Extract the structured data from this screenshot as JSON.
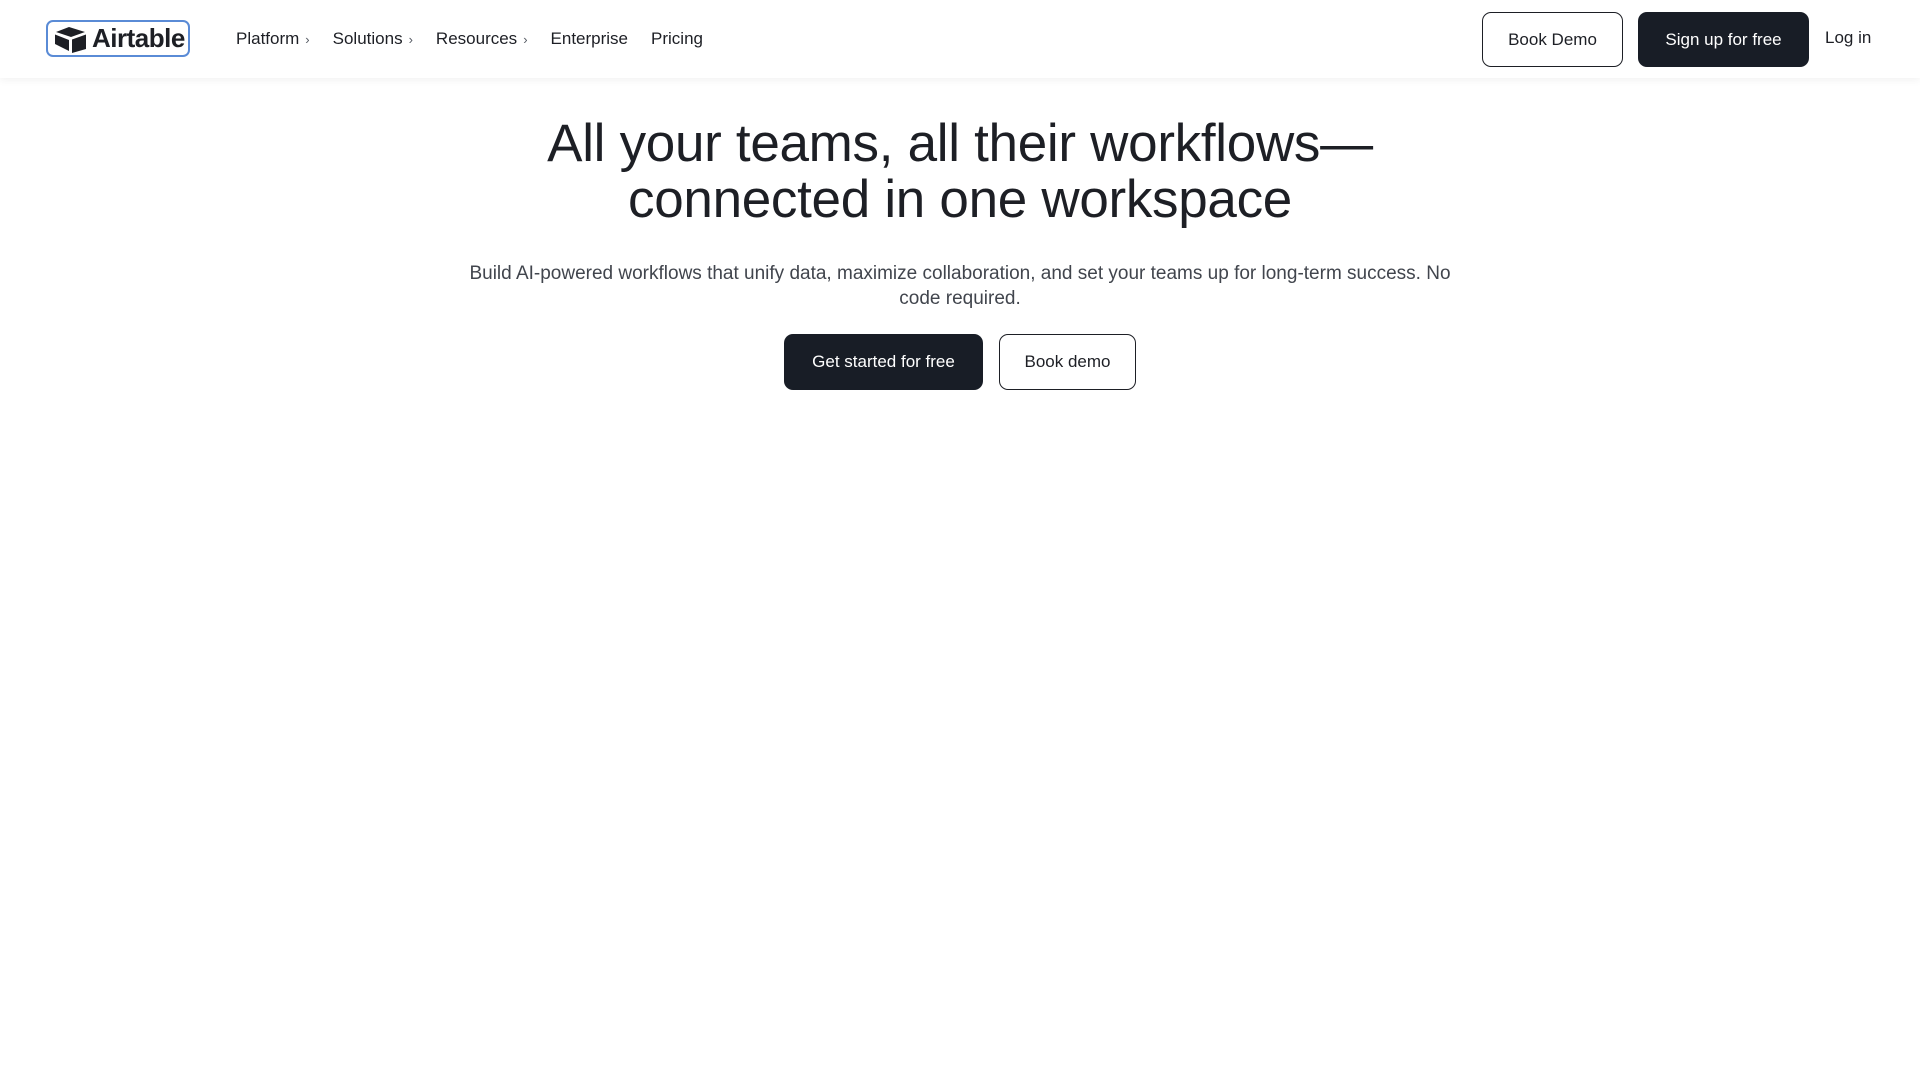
{
  "header": {
    "logo": {
      "text": "Airtable",
      "icon": "airtable-logo-icon",
      "border_color": "#5a8bd6"
    },
    "nav": [
      {
        "label": "Platform",
        "has_chevron": true
      },
      {
        "label": "Solutions",
        "has_chevron": true
      },
      {
        "label": "Resources",
        "has_chevron": true
      },
      {
        "label": "Enterprise",
        "has_chevron": false
      },
      {
        "label": "Pricing",
        "has_chevron": false
      }
    ],
    "book_demo_label": "Book Demo",
    "signup_label": "Sign up for free",
    "login_label": "Log in"
  },
  "hero": {
    "title_line1": "All your teams, all their workflows—",
    "title_line2": "connected in one workspace",
    "subtitle": "Build AI-powered workflows that unify data, maximize collaboration, and set your teams up for long-term success. No code required.",
    "primary_cta": "Get started for free",
    "secondary_cta": "Book demo"
  },
  "colors": {
    "text": "#1d1f25",
    "dark_button": "#181d26",
    "subtitle": "#41454d"
  }
}
